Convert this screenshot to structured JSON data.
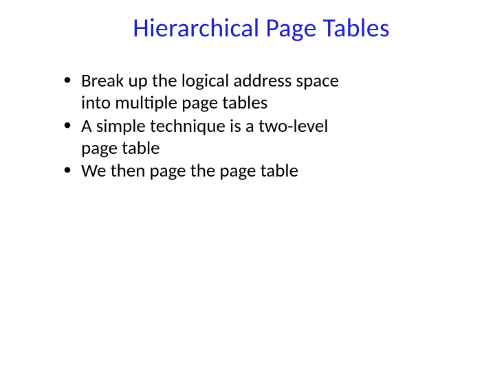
{
  "slide": {
    "title": "Hierarchical Page Tables",
    "bullets": [
      "Break up the logical address space into multiple page tables",
      "A simple technique is a two-level page table",
      "We then page the page table"
    ]
  }
}
